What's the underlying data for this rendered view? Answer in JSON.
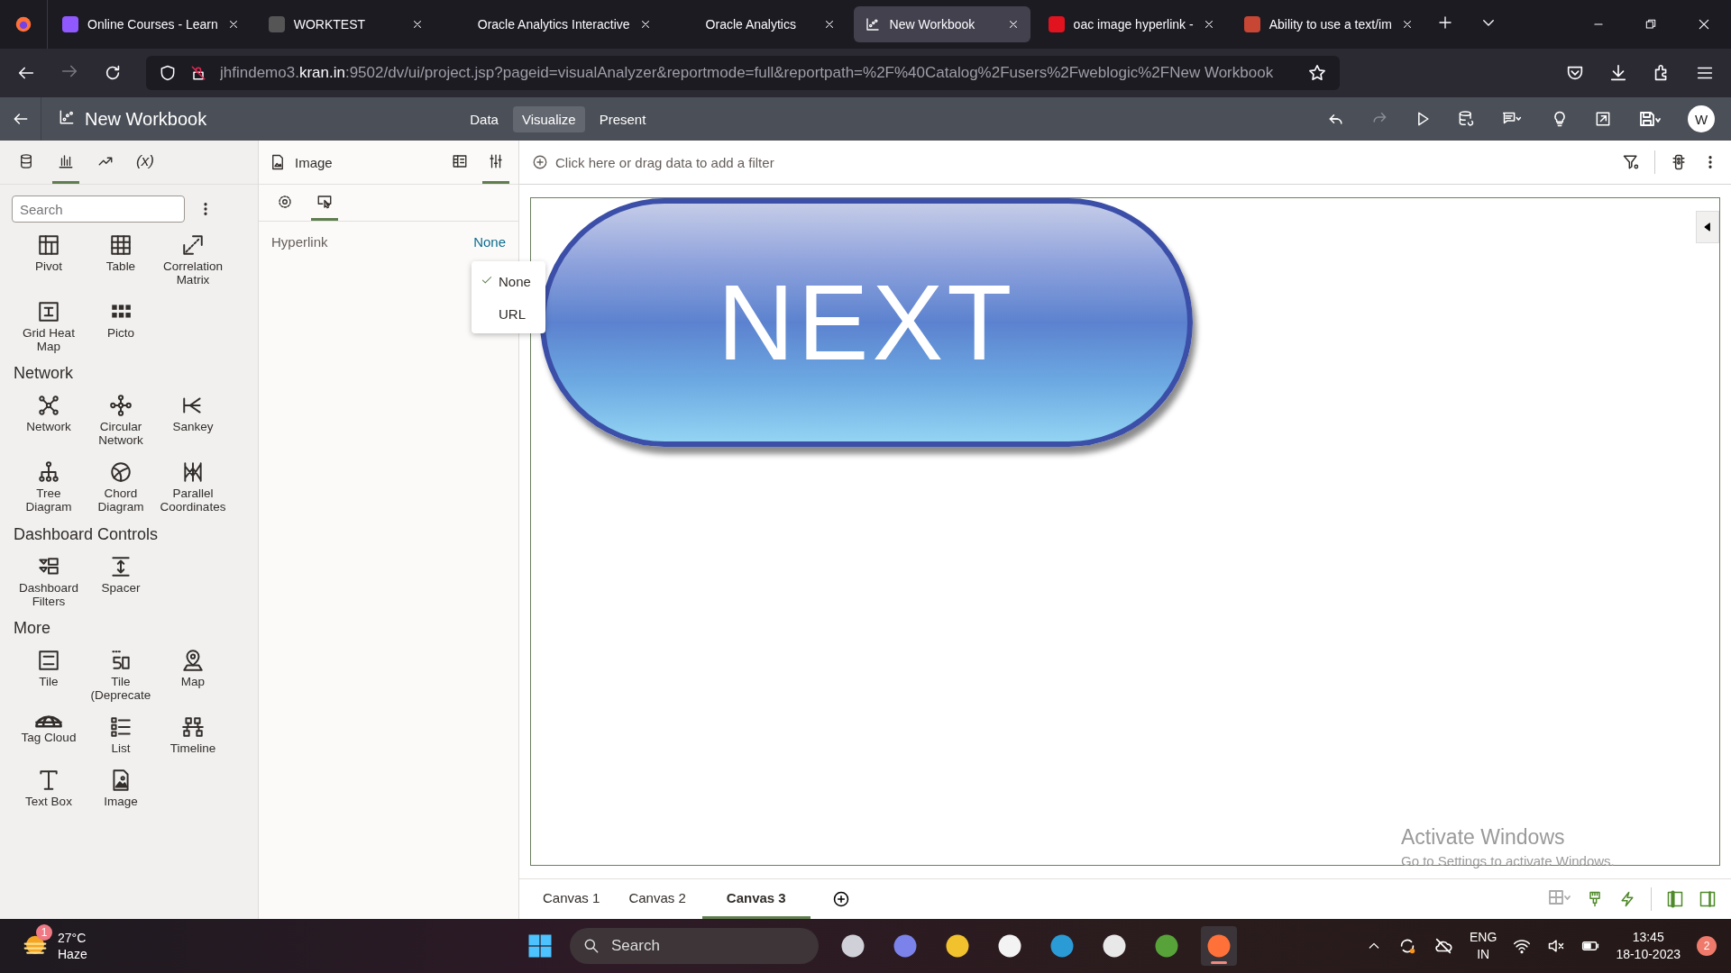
{
  "browser_tabs": [
    {
      "title": "Online Courses - Learn",
      "selected": false
    },
    {
      "title": "WORKTEST",
      "selected": false
    },
    {
      "title": "Oracle Analytics Interactive",
      "selected": false
    },
    {
      "title": "Oracle Analytics",
      "selected": false
    },
    {
      "title": "New Workbook",
      "selected": true
    },
    {
      "title": "oac image hyperlink -",
      "selected": false
    },
    {
      "title": "Ability to use a text/im",
      "selected": false
    }
  ],
  "address_bar": {
    "url": "jhfindemo3.**kran.in**:9502/dv/ui/project.jsp?pageid=visualAnalyzer&reportmode=full&reportpath=%2F%40Catalog%2Fusers%2Fweblogic%2FNew Workbook"
  },
  "app_header": {
    "title": "New Workbook",
    "modes": [
      {
        "label": "Data",
        "selected": false
      },
      {
        "label": "Visualize",
        "selected": true
      },
      {
        "label": "Present",
        "selected": false
      }
    ],
    "avatar": "W"
  },
  "left_panel": {
    "tabs": [
      {
        "kind": "icon",
        "selected": false
      },
      {
        "kind": "icon",
        "selected": true
      },
      {
        "kind": "icon",
        "selected": false
      },
      {
        "kind": "text",
        "label": "(x)",
        "selected": false
      }
    ],
    "search": {
      "placeholder": "Search"
    },
    "sections": [
      {
        "items": [
          "Pivot",
          "Table",
          "Correlation Matrix",
          "Grid Heat Map",
          "Picto"
        ]
      },
      {
        "title": "Network",
        "items": [
          "Network",
          "Circular Network",
          "Sankey",
          "Tree Diagram",
          "Chord Diagram",
          "Parallel Coordinates"
        ]
      },
      {
        "title": "Dashboard Controls",
        "items": [
          "Dashboard Filters",
          "Spacer"
        ]
      },
      {
        "title": "More",
        "items": [
          "Tile",
          "Tile (Deprecate",
          "Map",
          "Tag Cloud",
          "List",
          "Timeline",
          "Text Box",
          "Image"
        ]
      }
    ]
  },
  "properties": {
    "title": "Image",
    "header_tabs": [
      {
        "selected": false
      },
      {
        "selected": true
      }
    ],
    "sub_tabs": [
      {
        "selected": false
      },
      {
        "selected": true
      }
    ],
    "rows": [
      {
        "label": "Hyperlink",
        "value": "None"
      }
    ],
    "menu": [
      {
        "label": "None",
        "checked": true
      },
      {
        "label": "URL",
        "checked": false
      }
    ]
  },
  "filter_bar": {
    "hint": "Click here or drag data to add a filter"
  },
  "canvas": {
    "image_text": "NEXT"
  },
  "canvas_tabs": [
    {
      "label": "Canvas 1",
      "selected": false
    },
    {
      "label": "Canvas 2",
      "selected": false
    },
    {
      "label": "Canvas 3",
      "selected": true
    }
  ],
  "taskbar": {
    "weather": {
      "badge": "1",
      "temperature": "27°C",
      "condition": "Haze"
    },
    "search_placeholder": "Search",
    "pinned_apps": [
      {
        "active": false
      },
      {
        "active": false
      },
      {
        "active": false
      },
      {
        "active": false
      },
      {
        "active": false
      },
      {
        "active": false
      },
      {
        "active": false
      },
      {
        "active": true
      }
    ],
    "language": [
      "ENG",
      "IN"
    ],
    "time": "13:45",
    "date": "18-10-2023",
    "notifications": "2"
  },
  "activation_notice": {
    "title": "Activate Windows",
    "subtitle": "Go to Settings to activate Windows."
  }
}
